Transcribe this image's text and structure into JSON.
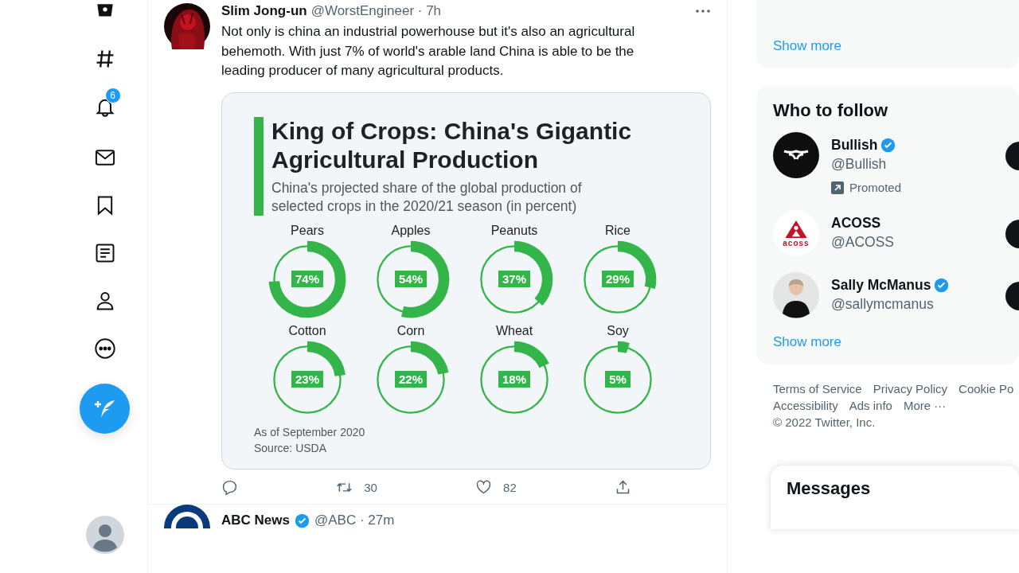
{
  "sidebar": {
    "notification_count": "6"
  },
  "tweet": {
    "author": "Slim Jong-un",
    "handle": "@WorstEngineer · 7h",
    "text": "Not only is china an industrial powerhouse but it's also an agricultural behemoth. With just 7% of world's arable land China is able to be the leading producer of many agricultural products.",
    "infographic": {
      "title": "King of Crops: China's Gigantic Agricultural Production",
      "subtitle": "China's projected share of the global production of selected crops in the 2020/21 season (in percent)",
      "crops": [
        {
          "name": "Pears",
          "reading": "74%"
        },
        {
          "name": "Apples",
          "reading": "54%"
        },
        {
          "name": "Peanuts",
          "reading": "37%"
        },
        {
          "name": "Rice",
          "reading": "29%"
        },
        {
          "name": "Cotton",
          "reading": "23%"
        },
        {
          "name": "Corn",
          "reading": "22%"
        },
        {
          "name": "Wheat",
          "reading": "18%"
        },
        {
          "name": "Soy",
          "reading": "5%"
        }
      ],
      "note": "As of September 2020",
      "source": "Source: USDA"
    },
    "retweets": "30",
    "likes": "82"
  },
  "next_tweet": {
    "author": "ABC News",
    "handle": "@ABC · 27m"
  },
  "right": {
    "top_link": "Show more",
    "who_to_follow": {
      "title": "Who to follow",
      "accounts": [
        {
          "name": "Bullish",
          "handle": "@Bullish",
          "verified": true,
          "kind": "bull",
          "promoted": "Promoted"
        },
        {
          "name": "ACOSS",
          "handle": "@ACOSS",
          "verified": false,
          "kind": "acoss",
          "logo_text": "acoss"
        },
        {
          "name": "Sally McManus",
          "handle": "@sallymcmanus",
          "verified": true
        }
      ],
      "link": "Show more"
    },
    "footer_links": [
      "Terms of Service",
      "Privacy Policy",
      "Cookie Po",
      "Accessibility",
      "Ads info",
      "More ···"
    ],
    "copyright": "© 2022 Twitter, Inc.",
    "messages": "Messages"
  }
}
